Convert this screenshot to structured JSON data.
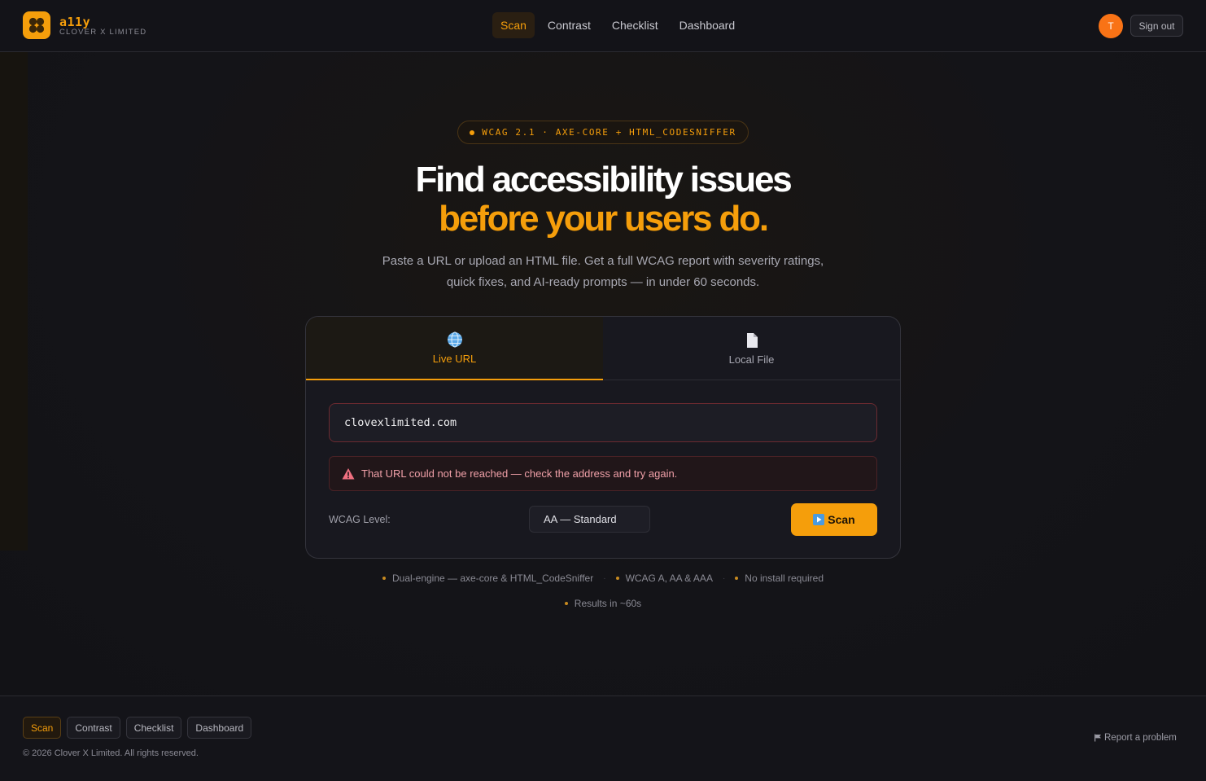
{
  "brand": {
    "name": "a11y",
    "subtitle": "CLOVER X LIMITED"
  },
  "nav": {
    "items": [
      "Scan",
      "Contrast",
      "Checklist",
      "Dashboard"
    ],
    "active": "Scan"
  },
  "user": {
    "initial": "T",
    "signout_label": "Sign out"
  },
  "hero": {
    "badge": "WCAG 2.1 · AXE-CORE + HTML_CODESNIFFER",
    "title_line1": "Find accessibility issues",
    "title_line2": "before your users do.",
    "subtitle": "Paste a URL or upload an HTML file. Get a full WCAG report with severity ratings, quick fixes, and AI-ready prompts — in under 60 seconds."
  },
  "scanner": {
    "tabs": [
      {
        "label": "Live URL",
        "icon": "globe-icon",
        "active": true
      },
      {
        "label": "Local File",
        "icon": "file-icon",
        "active": false
      }
    ],
    "url_value": "clovexlimited.com",
    "error_message": "That URL could not be reached — check the address and try again.",
    "level_label": "WCAG Level:",
    "level_value": "AA — Standard",
    "scan_label": "Scan"
  },
  "features": {
    "row1": [
      "Dual-engine — axe-core & HTML_CodeSniffer",
      "WCAG A, AA & AAA",
      "No install required"
    ],
    "row2": [
      "Results in ~60s"
    ]
  },
  "footer": {
    "nav": [
      "Scan",
      "Contrast",
      "Checklist",
      "Dashboard"
    ],
    "copyright": "© 2026 Clover X Limited. All rights reserved.",
    "report_label": "Report a problem"
  },
  "colors": {
    "accent": "#f59e0b",
    "background": "#131318",
    "error": "#f0a0a8",
    "avatar": "#f97316"
  }
}
